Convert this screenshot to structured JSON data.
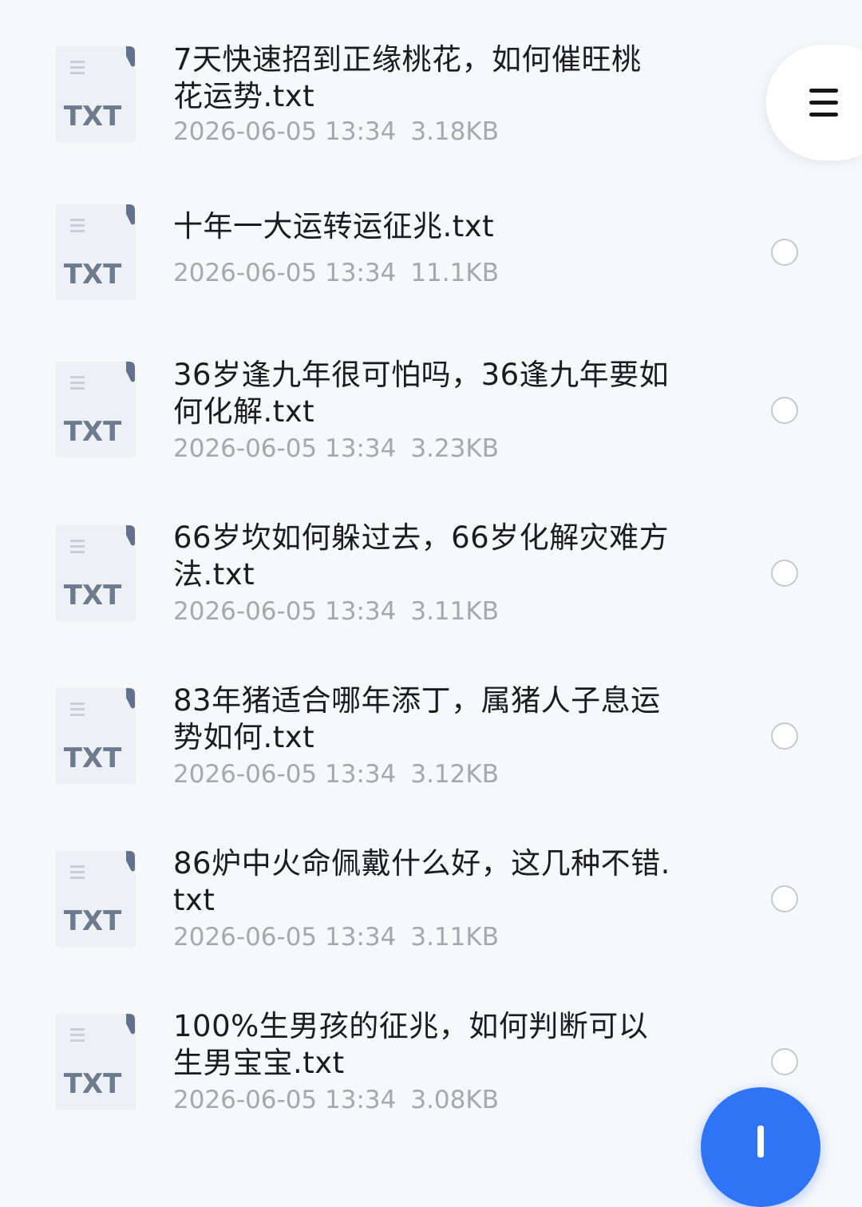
{
  "files": [
    {
      "title": "7天快速招到正缘桃花，如何催旺桃\n花运势.txt",
      "date": "2026-06-05 13:34",
      "size": "3.18KB",
      "icon": "txt-file-icon",
      "badge": "TXT"
    },
    {
      "title": "十年一大运转运征兆.txt",
      "date": "2026-06-05 13:34",
      "size": "11.1KB",
      "icon": "txt-file-icon",
      "badge": "TXT"
    },
    {
      "title": "36岁逢九年很可怕吗，36逢九年要如\n何化解.txt",
      "date": "2026-06-05 13:34",
      "size": "3.23KB",
      "icon": "txt-file-icon",
      "badge": "TXT"
    },
    {
      "title": "66岁坎如何躲过去，66岁化解灾难方\n法.txt",
      "date": "2026-06-05 13:34",
      "size": "3.11KB",
      "icon": "txt-file-icon",
      "badge": "TXT"
    },
    {
      "title": "83年猪适合哪年添丁，属猪人子息运\n势如何.txt",
      "date": "2026-06-05 13:34",
      "size": "3.12KB",
      "icon": "txt-file-icon",
      "badge": "TXT"
    },
    {
      "title": "86炉中火命佩戴什么好，这几种不错.\ntxt",
      "date": "2026-06-05 13:34",
      "size": "3.11KB",
      "icon": "txt-file-icon",
      "badge": "TXT"
    },
    {
      "title": "100%生男孩的征兆，如何判断可以\n生男宝宝.txt",
      "date": "2026-06-05 13:34",
      "size": "3.08KB",
      "icon": "txt-file-icon",
      "badge": "TXT"
    }
  ],
  "menu": {
    "icon": "hamburger-menu-icon"
  },
  "fab": {
    "icon": "plus-icon",
    "color": "#2f74f4"
  },
  "colors": {
    "background": "#f7f8fa",
    "title_text": "#1c1c1e",
    "meta_text": "#a6a8ad",
    "radio_border": "#c6c8cc",
    "icon_label": "#6e7b8f"
  }
}
